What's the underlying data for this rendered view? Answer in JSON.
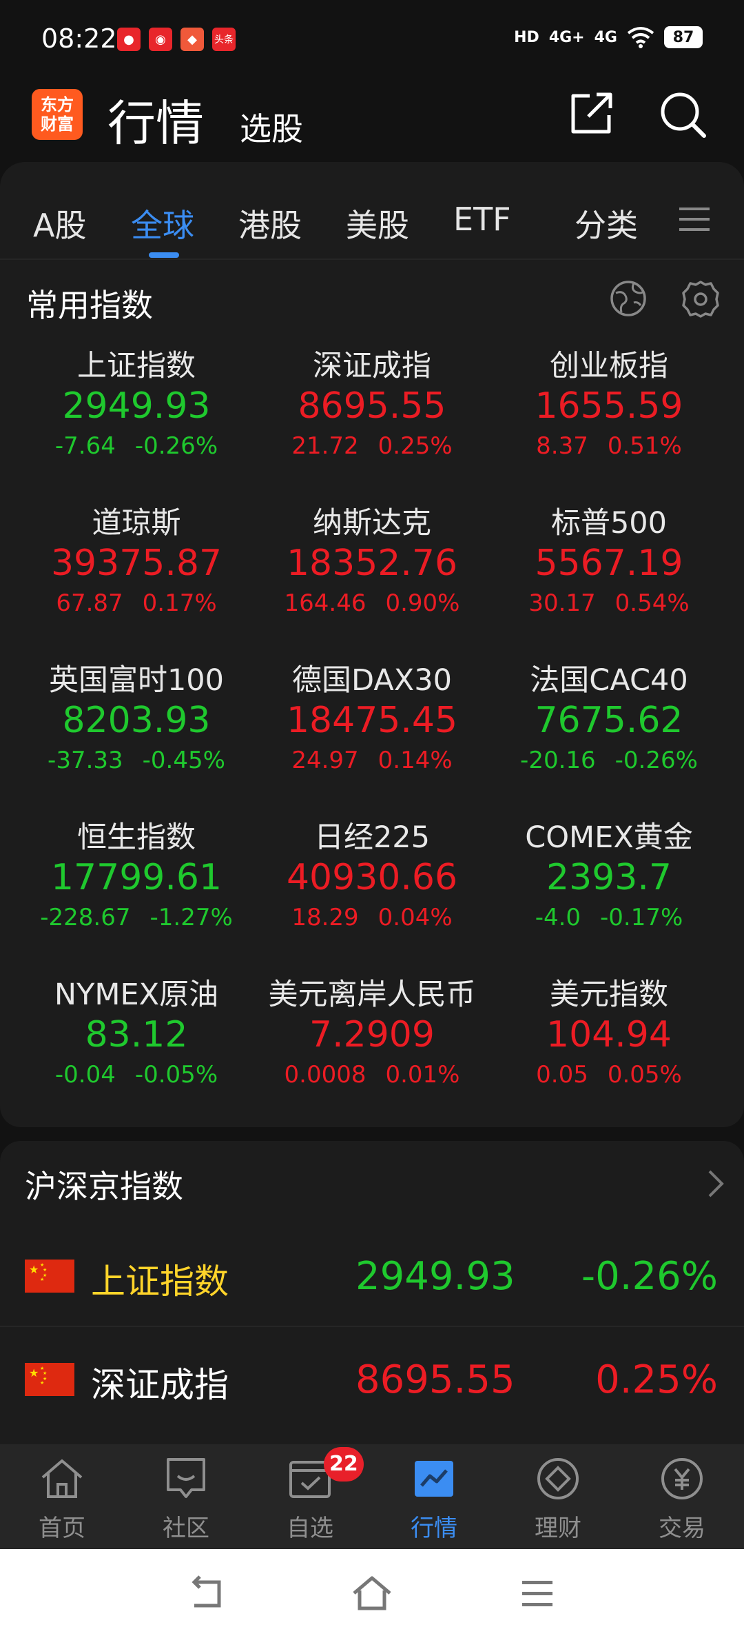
{
  "status_bar": {
    "time": "08:22",
    "notification_icons": [
      {
        "icon": "app-notif-icon-1",
        "color": "#e8262b",
        "glyph": "●"
      },
      {
        "icon": "weibo-icon",
        "color": "#e8262b",
        "glyph": "◉"
      },
      {
        "icon": "app-notif-icon-3",
        "color": "#f0593a",
        "glyph": "◆"
      },
      {
        "icon": "toutiao-icon",
        "color": "#e8262b",
        "glyph": "头条"
      }
    ],
    "signal_labels": [
      "HD",
      "4G+",
      "4G"
    ],
    "battery": "87"
  },
  "header": {
    "logo_text": "东方财富",
    "title": "行情",
    "subtitle": "选股"
  },
  "tabs": [
    {
      "label": "A股",
      "x": 0
    },
    {
      "label": "全球",
      "x": 0
    },
    {
      "label": "港股",
      "x": 0
    },
    {
      "label": "美股",
      "x": 0
    },
    {
      "label": "ETF",
      "x": 0
    },
    {
      "label": "分类",
      "x": 0
    }
  ],
  "common_index": {
    "title": "常用指数",
    "items": [
      {
        "name": "上证指数",
        "price": "2949.93",
        "change": "-7.64",
        "pct": "-0.26%",
        "trend": "down"
      },
      {
        "name": "深证成指",
        "price": "8695.55",
        "change": "21.72",
        "pct": "0.25%",
        "trend": "up"
      },
      {
        "name": "创业板指",
        "price": "1655.59",
        "change": "8.37",
        "pct": "0.51%",
        "trend": "up"
      },
      {
        "name": "道琼斯",
        "price": "39375.87",
        "change": "67.87",
        "pct": "0.17%",
        "trend": "up"
      },
      {
        "name": "纳斯达克",
        "price": "18352.76",
        "change": "164.46",
        "pct": "0.90%",
        "trend": "up"
      },
      {
        "name": "标普500",
        "price": "5567.19",
        "change": "30.17",
        "pct": "0.54%",
        "trend": "up"
      },
      {
        "name": "英国富时100",
        "price": "8203.93",
        "change": "-37.33",
        "pct": "-0.45%",
        "trend": "down"
      },
      {
        "name": "德国DAX30",
        "price": "18475.45",
        "change": "24.97",
        "pct": "0.14%",
        "trend": "up"
      },
      {
        "name": "法国CAC40",
        "price": "7675.62",
        "change": "-20.16",
        "pct": "-0.26%",
        "trend": "down"
      },
      {
        "name": "恒生指数",
        "price": "17799.61",
        "change": "-228.67",
        "pct": "-1.27%",
        "trend": "down"
      },
      {
        "name": "日经225",
        "price": "40930.66",
        "change": "18.29",
        "pct": "0.04%",
        "trend": "up"
      },
      {
        "name": "COMEX黄金",
        "price": "2393.7",
        "change": "-4.0",
        "pct": "-0.17%",
        "trend": "down"
      },
      {
        "name": "NYMEX原油",
        "price": "83.12",
        "change": "-0.04",
        "pct": "-0.05%",
        "trend": "down"
      },
      {
        "name": "美元离岸人民币",
        "price": "7.2909",
        "change": "0.0008",
        "pct": "0.01%",
        "trend": "up"
      },
      {
        "name": "美元指数",
        "price": "104.94",
        "change": "0.05",
        "pct": "0.05%",
        "trend": "up"
      }
    ]
  },
  "shsz_index": {
    "title": "沪深京指数",
    "rows": [
      {
        "name": "上证指数",
        "price": "2949.93",
        "pct": "-0.26%",
        "trend": "down"
      },
      {
        "name": "深证成指",
        "price": "8695.55",
        "pct": "0.25%",
        "trend": "up"
      }
    ]
  },
  "bottom_nav": {
    "items": [
      {
        "label": "首页",
        "icon": "home-icon"
      },
      {
        "label": "社区",
        "icon": "community-icon"
      },
      {
        "label": "自选",
        "icon": "watchlist-icon",
        "badge": "22"
      },
      {
        "label": "行情",
        "icon": "market-icon"
      },
      {
        "label": "理财",
        "icon": "wealth-icon"
      },
      {
        "label": "交易",
        "icon": "trade-icon"
      }
    ]
  },
  "colors": {
    "up": "#ec1c24",
    "down": "#1fc92e",
    "accent": "#3b8df2",
    "highlight": "#ffd42a",
    "logo": "#ff5a1f",
    "badge": "#e8202a"
  }
}
